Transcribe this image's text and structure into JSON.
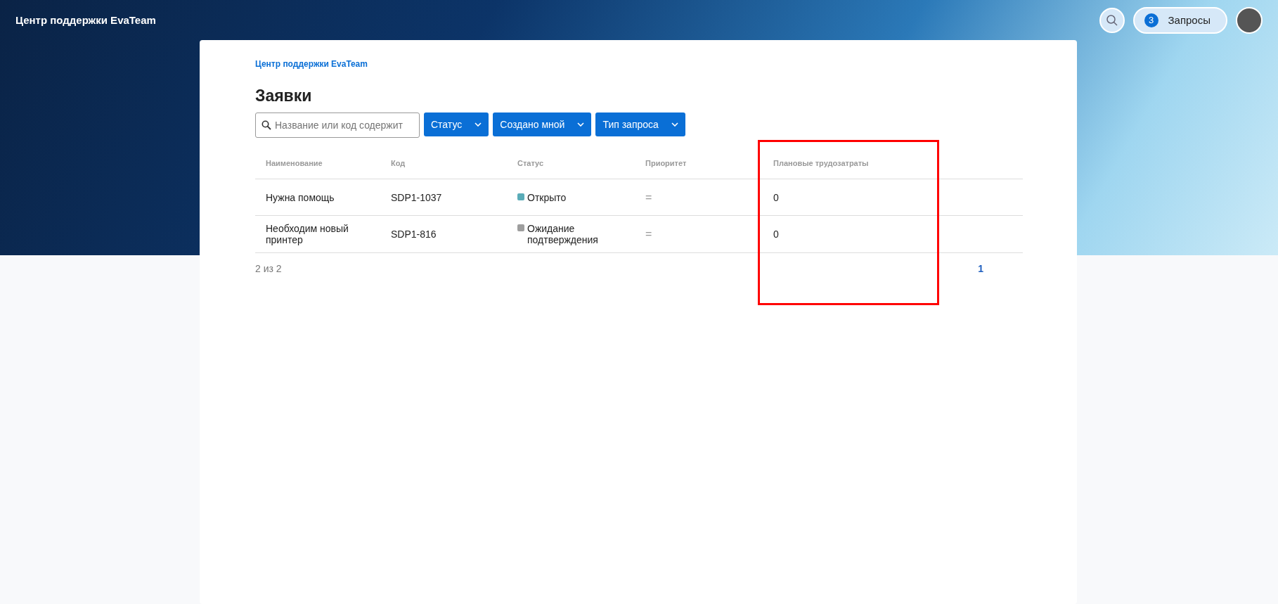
{
  "header": {
    "title": "Центр поддержки EvaTeam",
    "requests": {
      "count": "3",
      "label": "Запросы"
    }
  },
  "breadcrumb": "Центр поддержки EvaTeam",
  "page_title": "Заявки",
  "search": {
    "placeholder": "Название или код содержит"
  },
  "filters": [
    "Статус",
    "Создано мной",
    "Тип запроса"
  ],
  "table": {
    "columns": [
      "Наименование",
      "Код",
      "Статус",
      "Приоритет",
      "Плановые трудозатраты"
    ],
    "rows": [
      {
        "name": "Нужна помощь",
        "code": "SDP1-1037",
        "status": "Открыто",
        "color": "#5aacb8",
        "priority": "=",
        "effort": "0"
      },
      {
        "name": "Необходим новый принтер",
        "code": "SDP1-816",
        "status": "Ожидание подтверждения",
        "color": "#9e9e9e",
        "priority": "=",
        "effort": "0"
      }
    ]
  },
  "pagination": {
    "summary": "2 из 2",
    "pages": [
      {
        "label": "1",
        "selected": true
      }
    ]
  }
}
